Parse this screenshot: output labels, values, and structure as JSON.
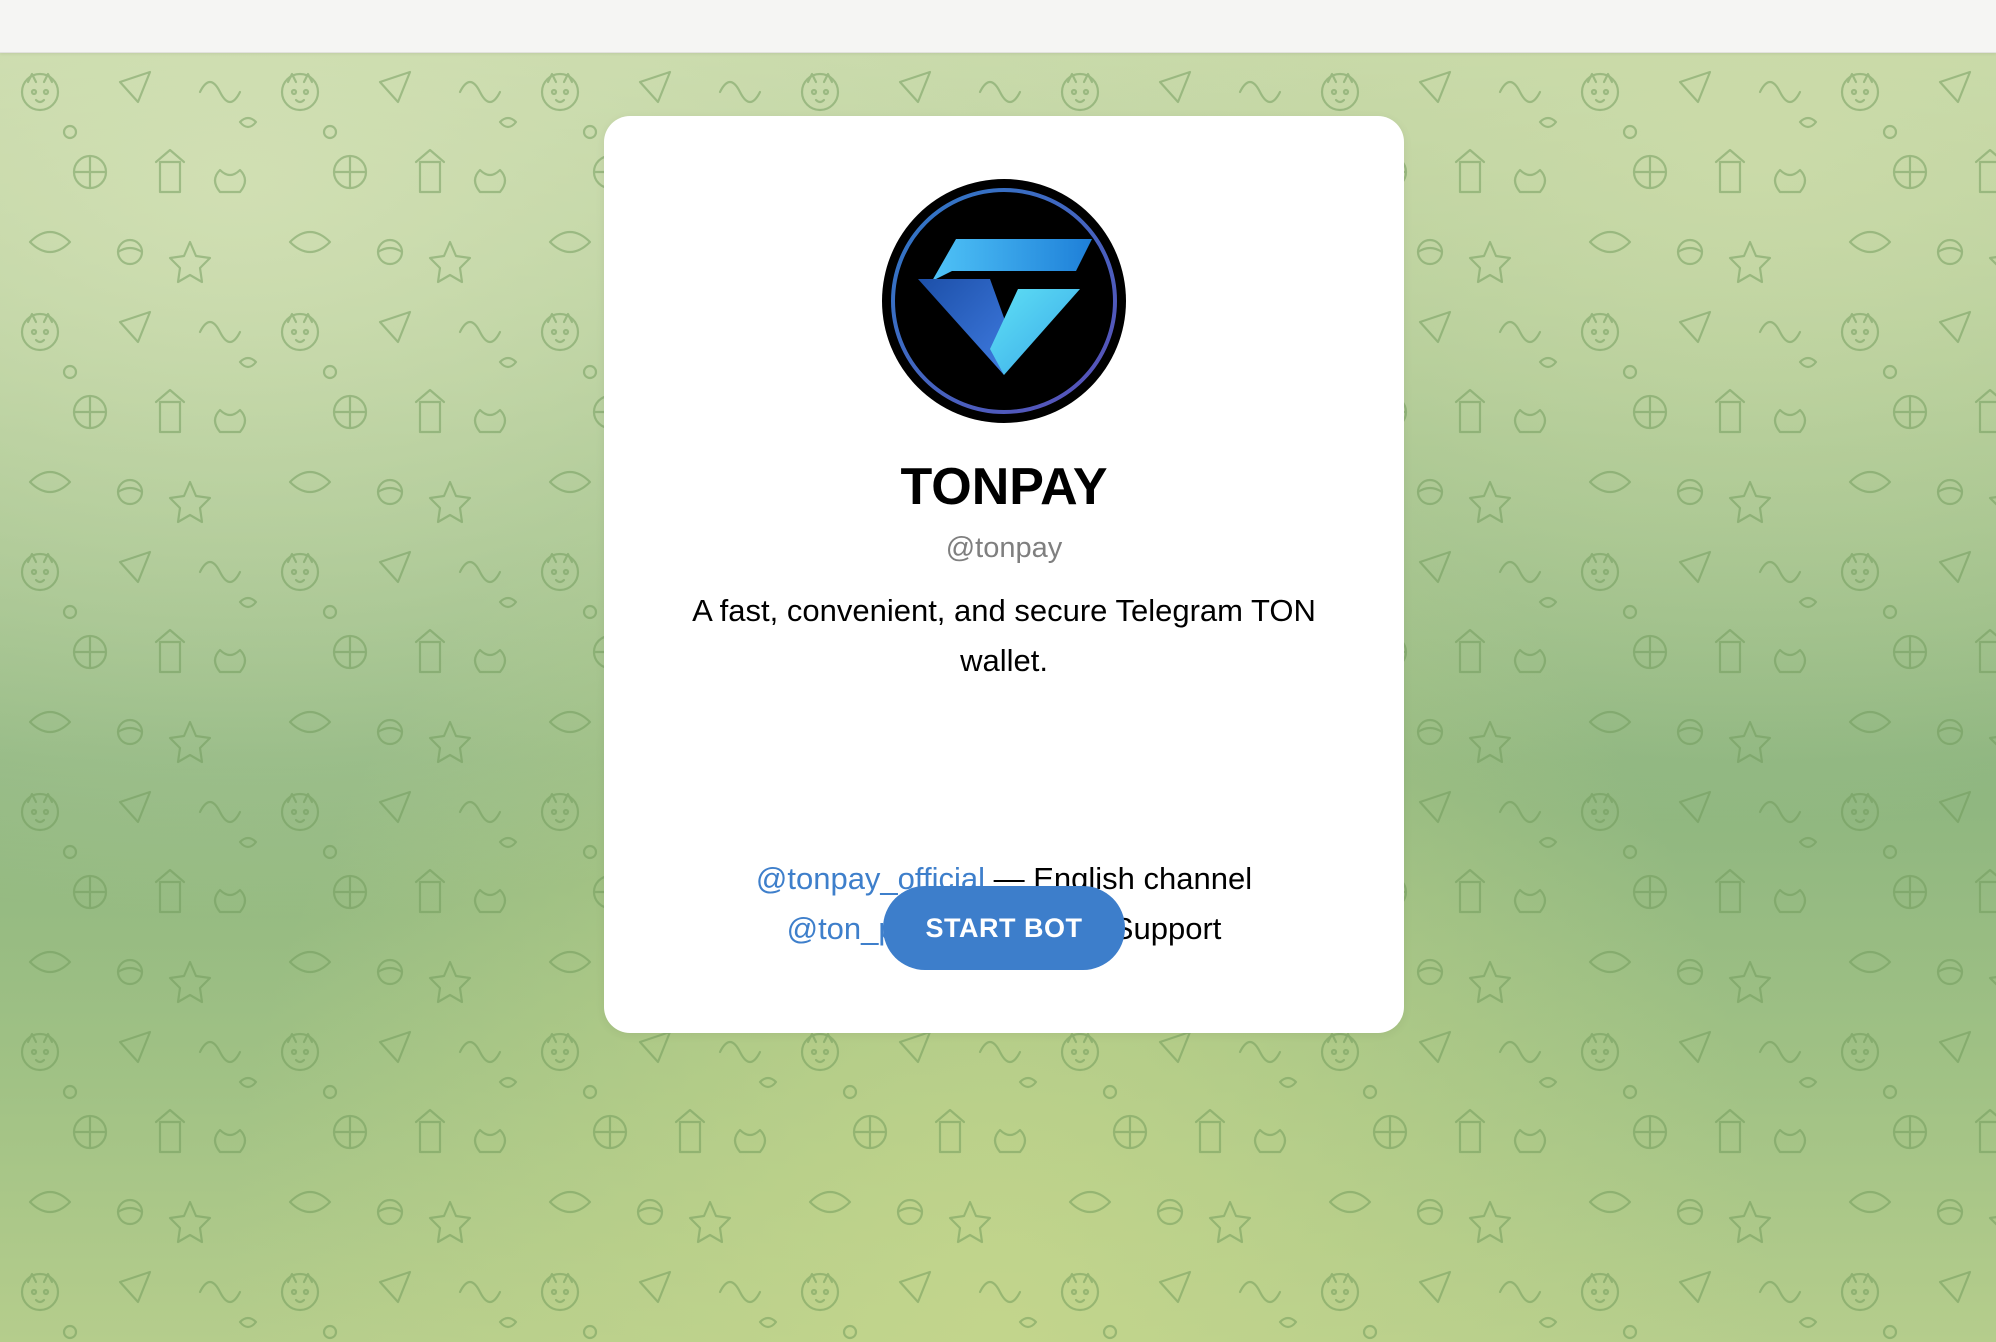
{
  "bot": {
    "name": "TONPAY",
    "username": "@tonpay",
    "description": "A fast, convenient, and secure Telegram TON wallet.",
    "avatar_icon": "tonpay-gem-logo-icon"
  },
  "links": [
    {
      "handle": "@tonpay_official",
      "suffix": " — English channel"
    },
    {
      "handle": "@ton_pay_help_bot",
      "suffix": " — Support"
    }
  ],
  "start_button_label": "START BOT",
  "colors": {
    "link": "#3e7fcb",
    "button": "#3d7ecb",
    "card": "#ffffff",
    "background": "#9fc08a"
  }
}
